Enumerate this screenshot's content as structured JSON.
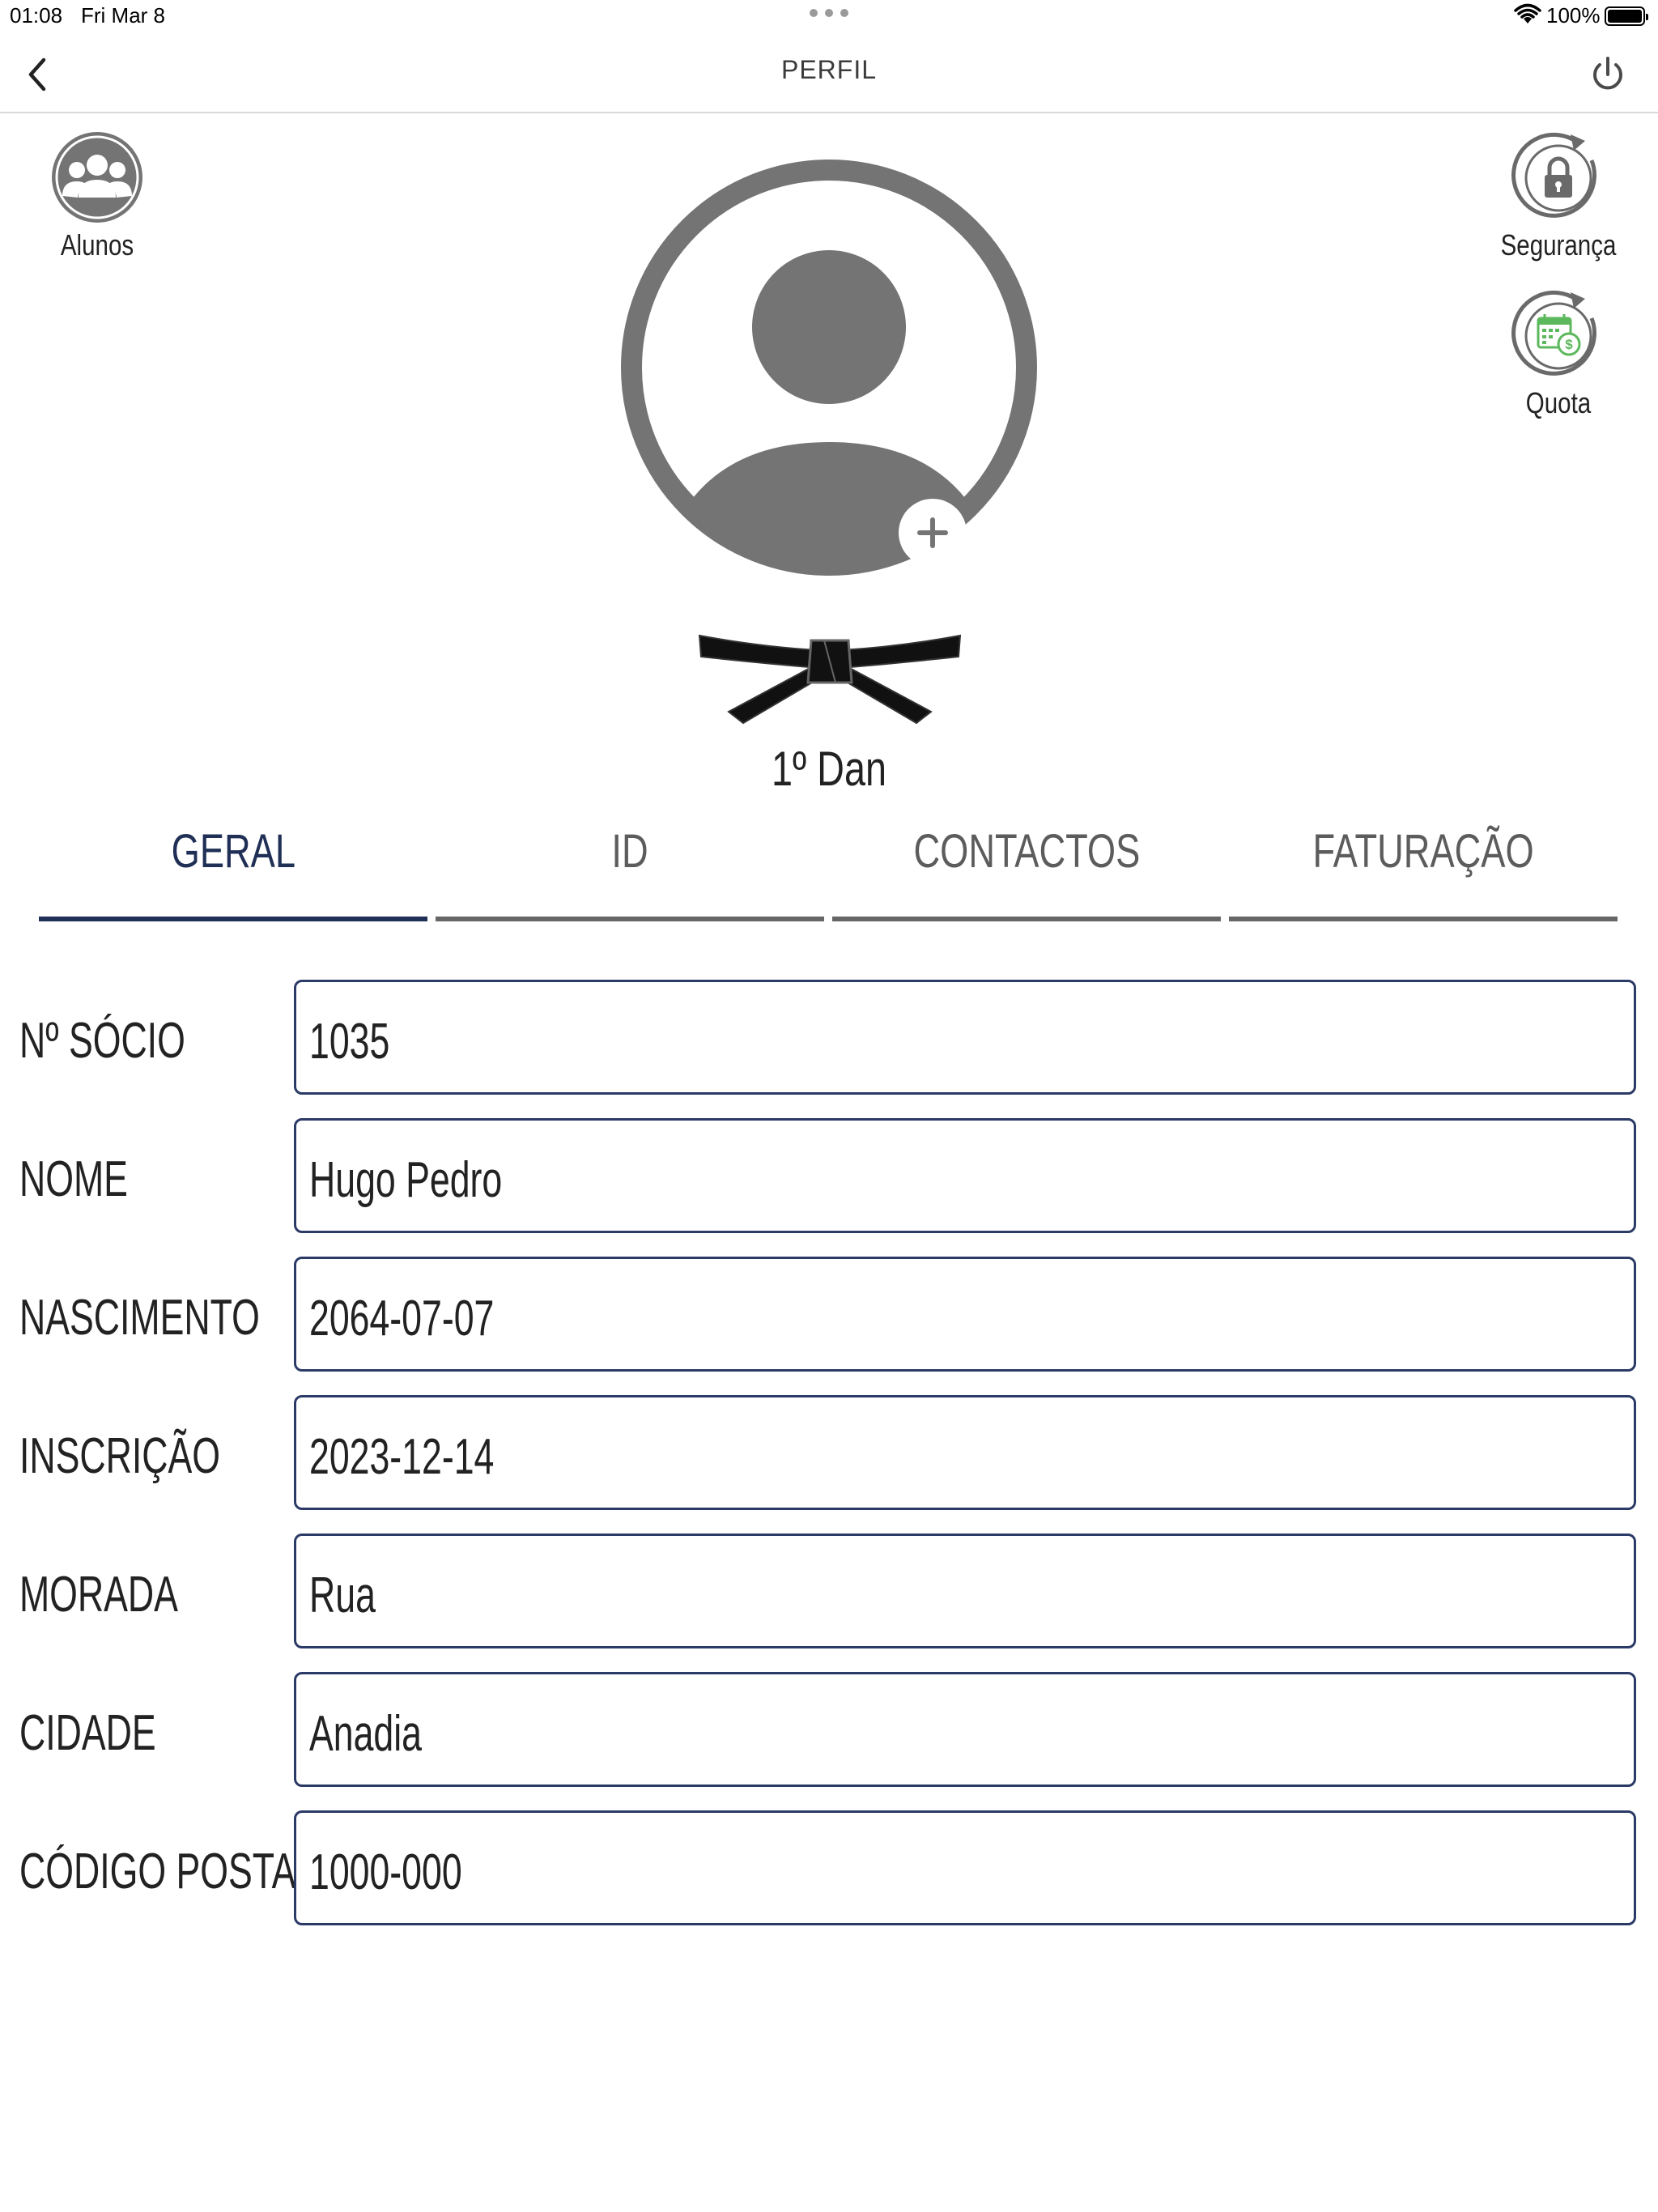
{
  "status_bar": {
    "time": "01:08",
    "date": "Fri Mar 8",
    "battery": "100%"
  },
  "nav": {
    "title": "PERFIL",
    "back_icon": "chevron-left-icon",
    "power_icon": "power-icon"
  },
  "shortcuts": {
    "alunos": {
      "label": "Alunos",
      "icon": "group-icon"
    },
    "seguranca": {
      "label": "Segurança",
      "icon": "lock-refresh-icon"
    },
    "quota": {
      "label": "Quota",
      "icon": "calendar-money-icon"
    }
  },
  "profile": {
    "avatar_icon": "user-avatar-icon",
    "add_photo_icon": "plus-icon",
    "belt_icon": "black-belt-icon",
    "belt_rank": "1º Dan"
  },
  "tabs": [
    {
      "label": "GERAL",
      "active": true
    },
    {
      "label": "ID",
      "active": false
    },
    {
      "label": "CONTACTOS",
      "active": false
    },
    {
      "label": "FATURAÇÃO",
      "active": false
    }
  ],
  "form": [
    {
      "label": "Nº SÓCIO",
      "value": "1035"
    },
    {
      "label": "NOME",
      "value": "Hugo Pedro"
    },
    {
      "label": "NASCIMENTO",
      "value": "2064-07-07"
    },
    {
      "label": "INSCRIÇÃO",
      "value": "2023-12-14"
    },
    {
      "label": "MORADA",
      "value": "Rua"
    },
    {
      "label": "CIDADE",
      "value": "Anadia"
    },
    {
      "label": "CÓDIGO POSTAL",
      "value": "1000-000"
    }
  ],
  "colors": {
    "accent": "#1f2f55",
    "icon_gray": "#747474",
    "quota_green": "#5cb85c"
  }
}
